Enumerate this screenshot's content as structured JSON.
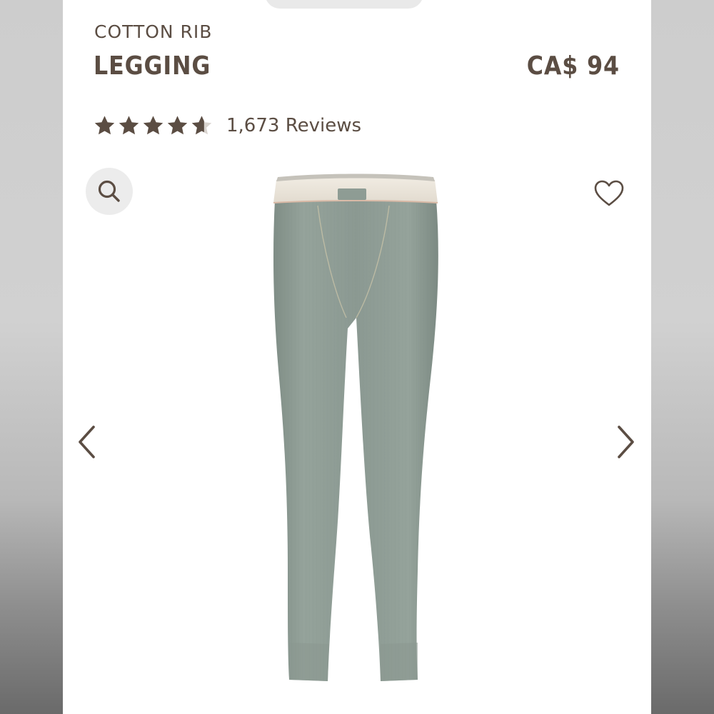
{
  "product": {
    "subtitle": "COTTON RIB",
    "title": "LEGGING",
    "price": "CA$ 94",
    "rating": 4.6,
    "reviews_label": "1,673 Reviews",
    "image_alt": "Cotton rib legging in sage green with cream waistband"
  },
  "icons": {
    "search": "search-icon",
    "favorite": "heart-icon",
    "prev": "chevron-left-icon",
    "next": "chevron-right-icon"
  },
  "colors": {
    "text": "#5b4d43",
    "star": "#5b4d43",
    "star_empty": "#d9d4cf",
    "legging": "#8e9c94",
    "waistband": "#ece6dc"
  }
}
